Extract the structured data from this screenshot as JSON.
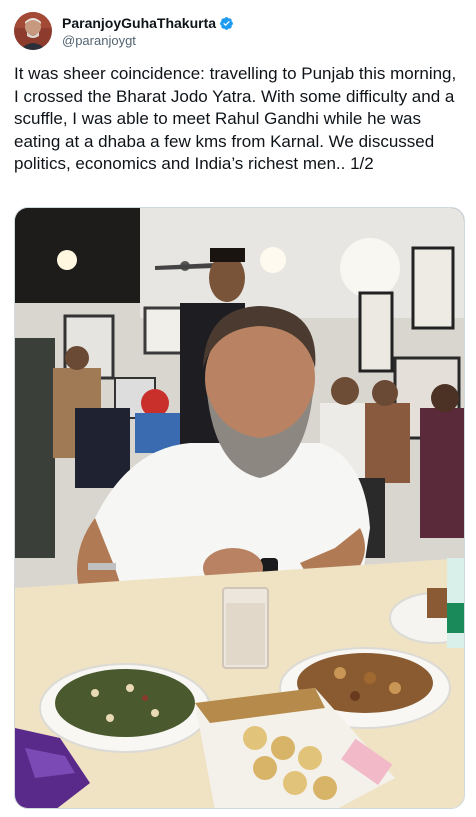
{
  "author": {
    "display_name": "ParanjoyGuhaThakurta",
    "handle": "@paranjoygt",
    "avatar_icon": "avatar-photo",
    "verified_icon": "verified-badge-icon",
    "verified_color": "#1d9bf0"
  },
  "tweet": {
    "text": "It was sheer coincidence: travelling to Punjab this morning, I crossed the Bharat Jodo Yatra. With some difficulty and a scuffle, I was able to meet Rahul Gandhi while he was eating at a dhaba a few kms from Karnal. We discussed politics, economics and India’s richest men.. 1/2"
  },
  "media": {
    "kind": "photo",
    "subject": "photo-of-man-eating-at-dhaba"
  }
}
